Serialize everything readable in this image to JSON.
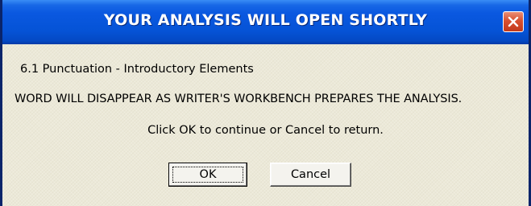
{
  "dialog": {
    "title": "YOUR ANALYSIS WILL OPEN SHORTLY",
    "close_icon": "close-icon",
    "line1": "6.1 Punctuation - Introductory Elements",
    "line2": "WORD WILL DISAPPEAR AS WRITER'S WORKBENCH PREPARES THE ANALYSIS.",
    "line3": "Click OK to continue or Cancel to return.",
    "ok_label": "OK",
    "cancel_label": "Cancel"
  },
  "colors": {
    "titlebar": "#0553d6",
    "close": "#d8502f",
    "background": "#ece9d8"
  }
}
